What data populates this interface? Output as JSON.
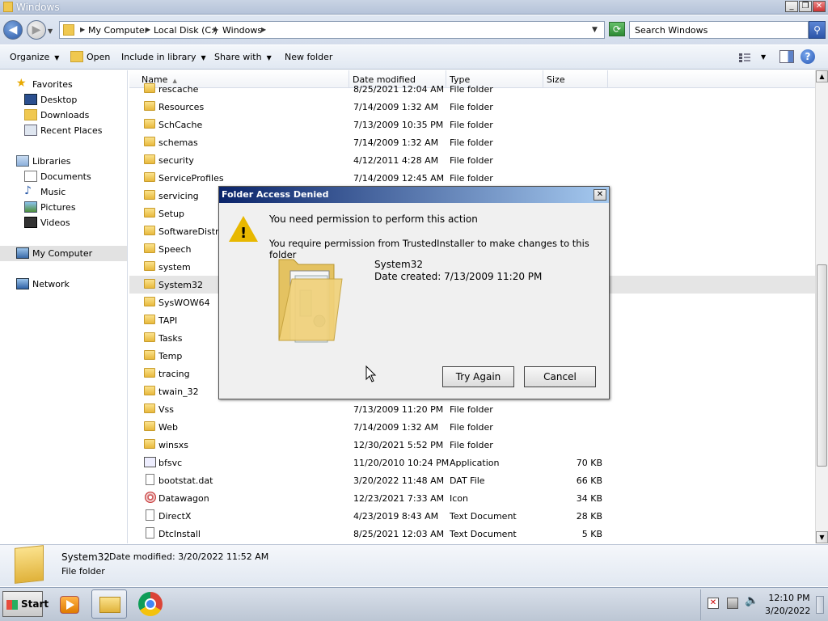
{
  "window": {
    "title": "Windows"
  },
  "address": {
    "crumbs": [
      "My Computer",
      "Local Disk (C:)",
      "Windows"
    ],
    "search_placeholder": "Search Windows"
  },
  "toolbar": {
    "organize": "Organize",
    "open": "Open",
    "include": "Include in library",
    "share": "Share with",
    "new_folder": "New folder"
  },
  "nav": {
    "favorites": "Favorites",
    "desktop": "Desktop",
    "downloads": "Downloads",
    "recent": "Recent Places",
    "libraries": "Libraries",
    "documents": "Documents",
    "music": "Music",
    "pictures": "Pictures",
    "videos": "Videos",
    "mycomputer": "My Computer",
    "network": "Network"
  },
  "columns": {
    "name": "Name",
    "date": "Date modified",
    "type": "Type",
    "size": "Size"
  },
  "files": [
    {
      "name": "rescache",
      "date": "8/25/2021 12:04 AM",
      "type": "File folder",
      "size": ""
    },
    {
      "name": "Resources",
      "date": "7/14/2009 1:32 AM",
      "type": "File folder",
      "size": ""
    },
    {
      "name": "SchCache",
      "date": "7/13/2009 10:35 PM",
      "type": "File folder",
      "size": ""
    },
    {
      "name": "schemas",
      "date": "7/14/2009 1:32 AM",
      "type": "File folder",
      "size": ""
    },
    {
      "name": "security",
      "date": "4/12/2011 4:28 AM",
      "type": "File folder",
      "size": ""
    },
    {
      "name": "ServiceProfiles",
      "date": "7/14/2009 12:45 AM",
      "type": "File folder",
      "size": ""
    },
    {
      "name": "servicing",
      "date": "",
      "type": "",
      "size": ""
    },
    {
      "name": "Setup",
      "date": "",
      "type": "",
      "size": ""
    },
    {
      "name": "SoftwareDistrib",
      "date": "",
      "type": "",
      "size": ""
    },
    {
      "name": "Speech",
      "date": "",
      "type": "",
      "size": ""
    },
    {
      "name": "system",
      "date": "",
      "type": "",
      "size": ""
    },
    {
      "name": "System32",
      "date": "",
      "type": "",
      "size": ""
    },
    {
      "name": "SysWOW64",
      "date": "",
      "type": "",
      "size": ""
    },
    {
      "name": "TAPI",
      "date": "",
      "type": "",
      "size": ""
    },
    {
      "name": "Tasks",
      "date": "",
      "type": "",
      "size": ""
    },
    {
      "name": "Temp",
      "date": "",
      "type": "",
      "size": ""
    },
    {
      "name": "tracing",
      "date": "",
      "type": "",
      "size": ""
    },
    {
      "name": "twain_32",
      "date": "",
      "type": "",
      "size": ""
    },
    {
      "name": "Vss",
      "date": "7/13/2009 11:20 PM",
      "type": "File folder",
      "size": ""
    },
    {
      "name": "Web",
      "date": "7/14/2009 1:32 AM",
      "type": "File folder",
      "size": ""
    },
    {
      "name": "winsxs",
      "date": "12/30/2021 5:52 PM",
      "type": "File folder",
      "size": ""
    },
    {
      "name": "bfsvc",
      "date": "11/20/2010 10:24 PM",
      "type": "Application",
      "size": "70 KB"
    },
    {
      "name": "bootstat.dat",
      "date": "3/20/2022 11:48 AM",
      "type": "DAT File",
      "size": "66 KB"
    },
    {
      "name": "Datawagon",
      "date": "12/23/2021 7:33 AM",
      "type": "Icon",
      "size": "34 KB"
    },
    {
      "name": "DirectX",
      "date": "4/23/2019 8:43 AM",
      "type": "Text Document",
      "size": "28 KB"
    },
    {
      "name": "DtcInstall",
      "date": "8/25/2021 12:03 AM",
      "type": "Text Document",
      "size": "5 KB"
    }
  ],
  "details": {
    "name": "System32",
    "modified": "Date modified: 3/20/2022 11:52 AM",
    "type": "File folder"
  },
  "dialog": {
    "title": "Folder Access Denied",
    "heading": "You need permission to perform this action",
    "message": "You require permission from TrustedInstaller to make changes to this folder",
    "item_name": "System32",
    "item_created": "Date created: 7/13/2009 11:20 PM",
    "try_again": "Try Again",
    "cancel": "Cancel"
  },
  "taskbar": {
    "start": "Start",
    "time": "12:10 PM",
    "date": "3/20/2022"
  }
}
